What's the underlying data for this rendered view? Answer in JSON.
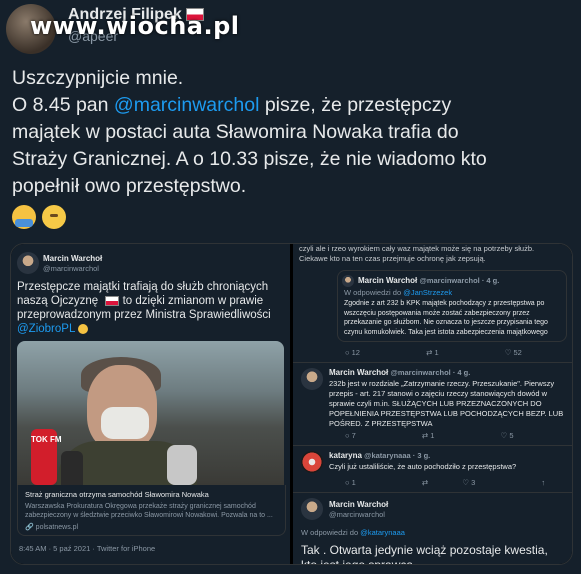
{
  "header": {
    "author_name": "Andrzej Filipek",
    "handle": "@apeer",
    "watermark": "www.wiocha.pl"
  },
  "tweet": {
    "line1": "Uszczypnijcie mnie.",
    "line2_pre": "O 8.45 pan ",
    "line2_mention": "@marcinwarchol",
    "line2_post": " pisze, że przestępczy",
    "line3": "majątek w postaci auta Sławomira Nowaka trafia do",
    "line4": "Straży Granicznej. A o 10.33 pisze, że nie wiadomo kto",
    "line5": "popełnił owo przestępstwo."
  },
  "left_shot": {
    "name": "Marcin Warchoł",
    "handle": "@marcinwarchol",
    "text_line1": "Przestępcze majątki trafiają do służb chroniących",
    "text_line2_pre": "naszą Ojczyznę",
    "text_line2_post": " to dzięki zmianom w prawie",
    "text_line3": "przeprowadzonym przez Ministra Sprawiedliwości",
    "text_mention": "@ZiobroPL",
    "mic_label": "TOK FM",
    "card_title": "Straż graniczna otrzyma samochód Sławomira Nowaka",
    "card_desc": "Warszawska Prokuratura Okręgowa przekaże straży granicznej samochód zabezpieczony w śledztwie przeciwko Sławomirowi Nowakowi. Pozwala na to ...",
    "card_source": "polsatnews.pl",
    "meta": "8:45 AM · 5 paź 2021 · Twitter for iPhone"
  },
  "right_shot": {
    "top_text_line1": "czyli ale i rzeo wyrokiem cały waz majątek może się na potrzeby służb.",
    "top_text_line2": "Ciekawe kto na ten czas przejmuje ochronę jak zepsują.",
    "reply1_name": "Marcin Warchoł",
    "reply1_meta": "@marcinwarchol · 4 g.",
    "reply1_to": "W odpowiedzi do ",
    "reply1_to_handle": "@JanStrzezek",
    "reply1_text": "Zgodnie z art 232 b KPK majątek pochodzący z przestępstwa po wszczęciu postępowania może zostać zabezpieczony przez przekazanie go służbom. Nie oznacza to jeszcze przypisania tego czynu komukolwiek. Taka jest istota zabezpieczenia majątkowego",
    "reply1_counts": [
      "12",
      "1",
      "52"
    ],
    "reply2_name": "Marcin Warchoł",
    "reply2_meta": "@marcinwarchol · 4 g.",
    "reply2_text": "232b jest w rozdziale „Zatrzymanie rzeczy. Przeszukanie\". Pierwszy przepis - art. 217 stanowi o zajęciu rzeczy stanowiących dowód w sprawie czyli m.in. SŁUŻĄCYCH LUB PRZEZNACZONYCH DO POPEŁNIENIA PRZESTĘPSTWA LUB POCHODZĄCYCH BEZP. LUB POŚRED. Z PRZESTĘPSTWA",
    "reply2_counts": [
      "7",
      "1",
      "5"
    ],
    "reply3_name": "kataryna",
    "reply3_meta": "@katarynaaa · 3 g.",
    "reply3_text": "Czyli już ustaliliście, że auto pochodziło z przestępstwa?",
    "reply3_counts": [
      "1",
      "3"
    ],
    "reply4_name": "Marcin Warchoł",
    "reply4_handle": "@marcinwarchol",
    "reply4_to": "W odpowiedzi do ",
    "reply4_to_handle": "@katarynaaa",
    "reply4_text": "Tak . Otwarta jedynie wciąż pozostaje kwestia, kto jest jego sprawcą."
  }
}
